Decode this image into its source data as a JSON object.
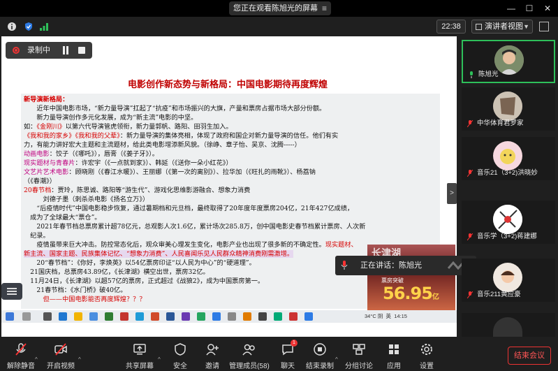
{
  "titlebar": {
    "share_notice": "您正在观看陈旭光的屏幕",
    "menu_glyph": "≡"
  },
  "toolbar": {
    "time": "22:38",
    "view_mode": "演讲者视图"
  },
  "recording": {
    "label": "录制中"
  },
  "slide": {
    "title": "电影创作新态势与新格局：中国电影期待再度辉煌",
    "lines": [
      {
        "segs": [
          {
            "t": "新导演新格局：",
            "c": "red b"
          }
        ]
      },
      {
        "segs": [
          {
            "t": "　　近年中国电影市场，“新力量导演”扛起了“抗疫”和市场振兴的大旗，产量和票房占据市场大部分份额。",
            "c": ""
          }
        ]
      },
      {
        "segs": [
          {
            "t": "　　新力量导演创作多元化发展，成为“新主流”电影的中坚。",
            "c": ""
          }
        ]
      },
      {
        "segs": [
          {
            "t": "如：",
            "c": ""
          },
          {
            "t": "《金刚川》",
            "c": "red"
          },
          {
            "t": "以第六代导演管虎领衔，新力量郭帆、路阳、田羽生加入。",
            "c": ""
          }
        ]
      },
      {
        "segs": [
          {
            "t": "《我和我的家乡》《我和我的父辈》",
            "c": "red"
          },
          {
            "t": "：新力量导演的集体亮相，体现了政府和国企对新力量导演的信任。他们有实",
            "c": ""
          }
        ]
      },
      {
        "segs": [
          {
            "t": "力，有能力讲好宏大主题和主流题材，给此类电影增添新风貌。（徐峥、章子怡、吴京、沈腾-----）",
            "c": ""
          }
        ]
      },
      {
        "segs": [
          {
            "t": "动画电影",
            "c": "mag"
          },
          {
            "t": "：饺子（《哪吒》），唇膏（《姜子牙》）。",
            "c": ""
          }
        ]
      },
      {
        "segs": [
          {
            "t": "现实题材与青春片",
            "c": "mag"
          },
          {
            "t": "：许宏宇（《一点就到家》）、韩延（《送你一朵小红花》）",
            "c": ""
          }
        ]
      },
      {
        "segs": [
          {
            "t": "文艺片艺术电影",
            "c": "mag"
          },
          {
            "t": "：顾晓刚（《春江水暖》）、王丽娜（《第一次的离别》）、拉华加（《旺扎的雨靴》）、杨荔钠",
            "c": ""
          }
        ]
      },
      {
        "segs": [
          {
            "t": "（《春潮》）",
            "c": ""
          }
        ]
      },
      {
        "segs": [
          {
            "t": "20春节档",
            "c": "red"
          },
          {
            "t": "：贾玲，陈思诚、路阳等“游生代”、游戏化思维影游融合、想象力消费",
            "c": ""
          }
        ]
      },
      {
        "segs": [
          {
            "t": "　　　刘德子墨（刺杀杀电影《扬名立万》）",
            "c": ""
          }
        ]
      },
      {
        "segs": [
          {
            "t": "　　“后疫情时代”中国电影稳步恢复，通过暑期档和元旦档，最终取得了20年度年度票房204亿，21年427亿成绩，",
            "c": ""
          }
        ]
      },
      {
        "segs": [
          {
            "t": "　成为了全球最大“票仓”。",
            "c": ""
          }
        ]
      },
      {
        "segs": [
          {
            "t": "　　2021年春节档总票房累计超78亿元，总观影人次1.6亿，累计场次285.8万，创中国电影史春节档累计票房、人次新",
            "c": ""
          }
        ]
      },
      {
        "segs": [
          {
            "t": "　纪录。",
            "c": ""
          }
        ]
      },
      {
        "segs": [
          {
            "t": "　　疫情虽带来巨大冲击。防控常态化后，观众审美心理发生变化，电影产业也出现了很多新的不确定性。",
            "c": ""
          },
          {
            "t": "现实题材、",
            "c": "red"
          }
        ]
      },
      {
        "segs": [
          {
            "t": "新主流、国家主题、民族集体记忆、“想象力消费”、人民喜闻乐见人民群众精神消费刚需激增。",
            "c": "red hl"
          }
        ]
      },
      {
        "segs": [
          {
            "t": "　　20“春节档”：《你好，李焕英》以54亿票房印证“以人民为中心”的“硬道理”。",
            "c": ""
          }
        ]
      },
      {
        "segs": [
          {
            "t": "　21国庆档，总票房43.89亿，《长津湖》横空出世，票房32亿。",
            "c": ""
          }
        ]
      },
      {
        "segs": [
          {
            "t": "　11月24日，《长津湖》以超57亿的票房，正式超过《战狼2》，成为中国票房第一。",
            "c": ""
          }
        ]
      },
      {
        "segs": [
          {
            "t": "　　21春节档：《水门桥》破40亿。",
            "c": ""
          }
        ]
      },
      {
        "segs": [
          {
            "t": "　　　但——中国电影能否再度辉煌？？？",
            "c": "red"
          }
        ]
      }
    ],
    "poster": {
      "big_number": "56.95",
      "unit": "亿",
      "caption": "票房突破",
      "top_text": "长津湖"
    }
  },
  "speaking": {
    "label": "正在讲话：陈旭光"
  },
  "taskbar": {
    "weather": "34°C 阴",
    "ime": "英",
    "clock": "14:15"
  },
  "sidebar": {
    "toggle_glyph": ">",
    "participants": [
      {
        "name": "陈旭光"
      },
      {
        "name": "中华体育君罗家"
      },
      {
        "name": "音乐21（3+2)洪晓妙"
      },
      {
        "name": "音乐学（3+2)蒋建娜"
      },
      {
        "name": "音乐211黄应豪"
      }
    ]
  },
  "controls": {
    "mute": "解除静音",
    "video": "开启视频",
    "share": "共享屏幕",
    "security": "安全",
    "invite": "邀请",
    "members": "管理成员(58)",
    "chat": "聊天",
    "chat_badge": "1",
    "record": "结束录制",
    "breakout": "分组讨论",
    "apps": "应用",
    "settings": "设置",
    "end": "结束会议"
  },
  "colors": {
    "accent_red": "#d60000",
    "active_green": "#2ec05a",
    "bg_dark": "#1f1f1f"
  }
}
